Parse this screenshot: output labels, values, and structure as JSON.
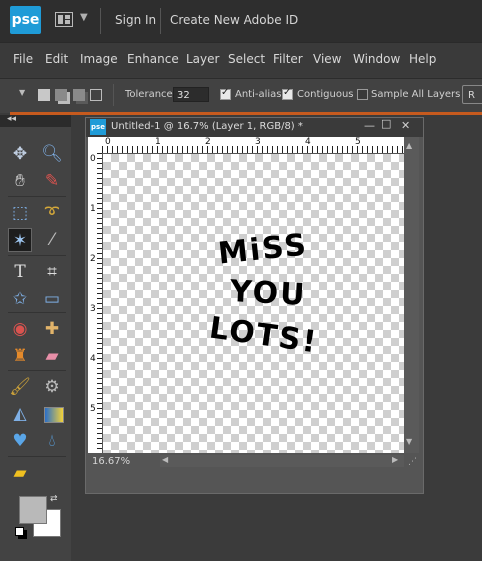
{
  "topbar": {
    "logo": "pse",
    "sign_in": "Sign In",
    "create_id": "Create New Adobe ID"
  },
  "menu": [
    "File",
    "Edit",
    "Image",
    "Enhance",
    "Layer",
    "Select",
    "Filter",
    "View",
    "Window",
    "Help"
  ],
  "options": {
    "tolerance_label": "Tolerance:",
    "tolerance_value": "32",
    "anti_alias": "Anti-alias",
    "contiguous": "Contiguous",
    "sample_all_layers": "Sample All Layers",
    "refine": "R",
    "anti_alias_checked": true,
    "contiguous_checked": true,
    "sample_all_checked": false
  },
  "document": {
    "icon_text": "pse",
    "title": "Untitled-1 @ 16.7% (Layer 1, RGB/8) *",
    "zoom": "16.67%",
    "ruler_h": [
      "0",
      "1",
      "2",
      "3",
      "4",
      "5"
    ],
    "ruler_v": [
      "0",
      "1",
      "2",
      "3",
      "4",
      "5"
    ],
    "artwork_lines": [
      "MiSS",
      "YOU",
      "LOTS!"
    ]
  },
  "colors": {
    "accent": "#c65a1e",
    "brand": "#1f9bd7",
    "foreground": "#b9b9b9",
    "background": "#ffffff"
  }
}
